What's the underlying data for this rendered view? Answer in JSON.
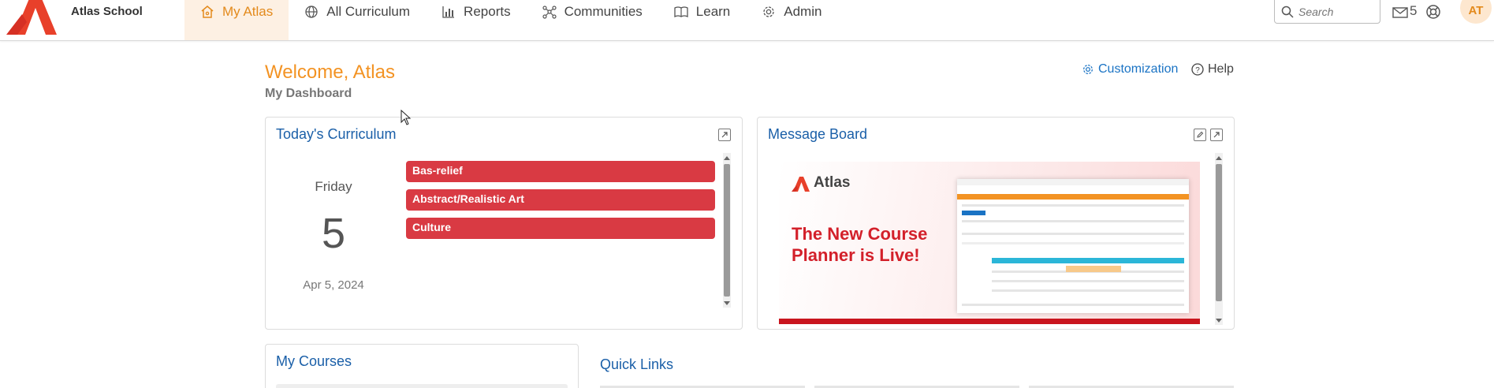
{
  "header": {
    "school_name": "Atlas School",
    "nav": [
      {
        "label": "My Atlas",
        "icon": "home-icon",
        "active": true
      },
      {
        "label": "All Curriculum",
        "icon": "globe-icon"
      },
      {
        "label": "Reports",
        "icon": "bar-chart-icon"
      },
      {
        "label": "Communities",
        "icon": "network-icon"
      },
      {
        "label": "Learn",
        "icon": "book-icon"
      },
      {
        "label": "Admin",
        "icon": "gear-icon"
      }
    ],
    "search_placeholder": "Search",
    "mail_count": "5",
    "avatar_initials": "AT"
  },
  "page": {
    "welcome": "Welcome, Atlas",
    "subtitle": "My Dashboard",
    "customization": "Customization",
    "help": "Help"
  },
  "curriculum": {
    "title": "Today's Curriculum",
    "day_name": "Friday",
    "day_number": "5",
    "date": "Apr 5, 2024",
    "lessons": [
      "Bas-relief",
      "Abstract/Realistic Art",
      "Culture"
    ]
  },
  "message_board": {
    "title": "Message Board",
    "banner_brand": "Atlas",
    "banner_headline": "The New Course Planner is Live!"
  },
  "courses": {
    "title": "My Courses"
  },
  "quick_links": {
    "title": "Quick Links"
  },
  "colors": {
    "accent_orange": "#f39323",
    "link_blue": "#1a5fa8",
    "lesson_red": "#d93a43",
    "banner_red": "#d3202a"
  }
}
